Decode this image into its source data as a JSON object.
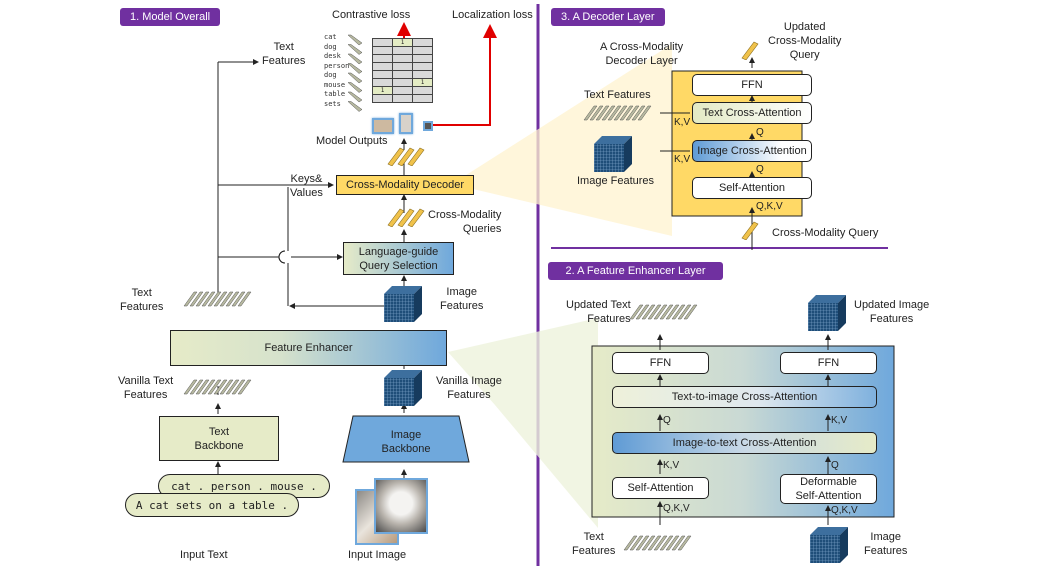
{
  "sections": {
    "overall": "1. Model Overall",
    "decoder": "3. A Decoder Layer",
    "enhancer": "2. A Feature Enhancer Layer"
  },
  "overall": {
    "losses": {
      "contrastive": "Contrastive loss",
      "localization": "Localization loss"
    },
    "text_features_top": [
      "Text",
      "Features"
    ],
    "words": [
      "cat",
      "dog",
      "desk",
      "person",
      "dog",
      "mouse",
      "table",
      "sets"
    ],
    "similarity_grid": {
      "rows": 8,
      "cols": 3,
      "hits": [
        {
          "row": 0,
          "col": 1,
          "value": "1"
        },
        {
          "row": 5,
          "col": 2,
          "value": "1"
        },
        {
          "row": 6,
          "col": 0,
          "value": "1"
        }
      ]
    },
    "model_outputs": "Model Outputs",
    "keys_values": [
      "Keys&",
      "Values"
    ],
    "decoder_box": "Cross-Modality Decoder",
    "queries_label": [
      "Cross-Modality",
      "Queries"
    ],
    "query_selection": [
      "Language-guide",
      "Query Selection"
    ],
    "text_features": [
      "Text",
      "Features"
    ],
    "image_features": [
      "Image",
      "Features"
    ],
    "feature_enhancer": "Feature Enhancer",
    "vanilla_text": [
      "Vanilla Text",
      "Features"
    ],
    "vanilla_image": [
      "Vanilla Image",
      "Features"
    ],
    "text_backbone": [
      "Text",
      "Backbone"
    ],
    "image_backbone": [
      "Image",
      "Backbone"
    ],
    "prompt_1": "cat . person . mouse .",
    "prompt_2": "A cat sets on a table .",
    "input_text": "Input Text",
    "input_image": "Input Image"
  },
  "decoder_layer": {
    "title": [
      "A Cross-Modality",
      "Decoder Layer"
    ],
    "updated_query": [
      "Updated",
      "Cross-Modality",
      "Query"
    ],
    "text_features": "Text Features",
    "image_features": "Image Features",
    "blocks": {
      "ffn": "FFN",
      "text_ca": "Text Cross-Attention",
      "image_ca": "Image Cross-Attention",
      "self_attn": "Self-Attention"
    },
    "kv": "K,V",
    "q": "Q",
    "qkv": "Q,K,V",
    "input_query": "Cross-Modality Query"
  },
  "enhancer_layer": {
    "updated_text": [
      "Updated Text",
      "Features"
    ],
    "updated_image": [
      "Updated Image",
      "Features"
    ],
    "ffn": "FFN",
    "t2i": "Text-to-image Cross-Attention",
    "i2t": "Image-to-text Cross-Attention",
    "self_attn": "Self-Attention",
    "deform": [
      "Deformable",
      "Self-Attention"
    ],
    "q": "Q",
    "kv": "K,V",
    "qkv": "Q,K,V",
    "text_features": [
      "Text",
      "Features"
    ],
    "image_features": [
      "Image",
      "Features"
    ]
  },
  "colors": {
    "purple": "#7030a0",
    "decoder_yellow": "#ffd966",
    "text_green": "#e6ebc8",
    "image_blue": "#6fa8dc",
    "loss_red": "#e00000"
  }
}
